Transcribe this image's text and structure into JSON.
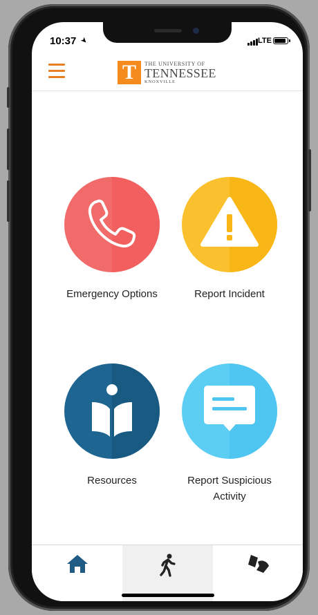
{
  "status_bar": {
    "time": "10:37",
    "network": "LTE"
  },
  "header": {
    "logo_mark": "T",
    "logo_line1": "THE UNIVERSITY OF",
    "logo_line2": "TENNESSEE",
    "logo_line3": "KNOXVILLE",
    "menu_icon": "hamburger-menu-icon"
  },
  "actions": [
    {
      "label": "Emergency Options",
      "icon": "phone-icon",
      "color": "#f26b6b"
    },
    {
      "label": "Report Incident",
      "icon": "warning-icon",
      "color": "#fbc02d"
    },
    {
      "label": "Resources",
      "icon": "book-reader-icon",
      "color": "#1f6591"
    },
    {
      "label": "Report Suspicious Activity",
      "icon": "chat-bubble-icon",
      "color": "#4ec6f1"
    }
  ],
  "bottom_nav": [
    {
      "icon": "home-icon",
      "active": true
    },
    {
      "icon": "walking-person-icon",
      "active": false
    },
    {
      "icon": "campus-map-icon",
      "active": false
    }
  ],
  "colors": {
    "accent": "#e67e22",
    "brand_orange": "#f58a1f",
    "nav_active": "#1f5b85"
  }
}
